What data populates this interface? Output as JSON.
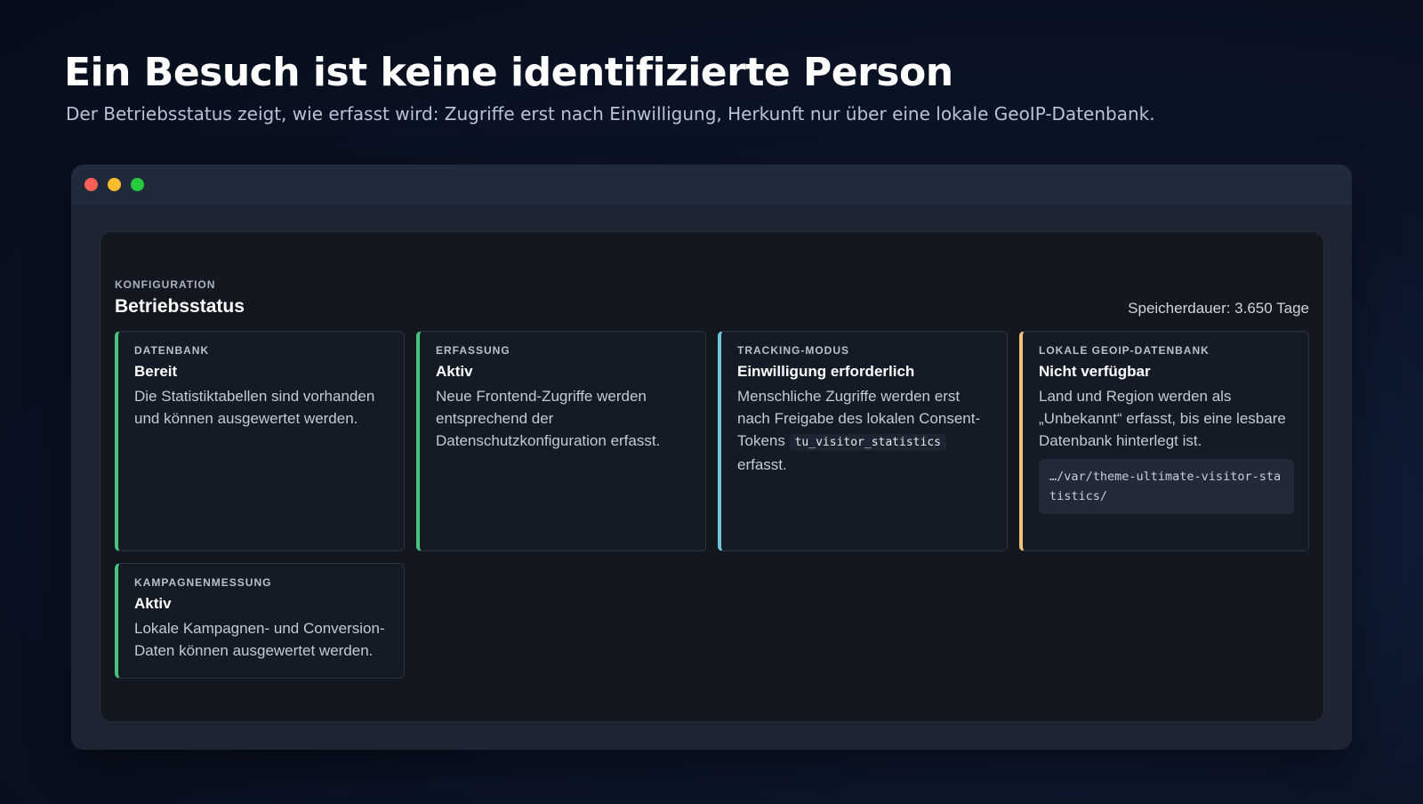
{
  "hero": {
    "title": "Ein Besuch ist keine identifizierte Person",
    "subtitle": "Der Betriebsstatus zeigt, wie erfasst wird: Zugriffe erst nach Einwilligung, Herkunft nur über eine lokale GeoIP-Datenbank."
  },
  "panel": {
    "eyebrow": "KONFIGURATION",
    "title": "Betriebsstatus",
    "retention": "Speicherdauer: 3.650 Tage"
  },
  "cards": [
    {
      "label": "DATENBANK",
      "status": "Bereit",
      "description": "Die Statistiktabellen sind vorhanden und können ausgewertet werden.",
      "accent": "#49c27e"
    },
    {
      "label": "ERFASSUNG",
      "status": "Aktiv",
      "description": "Neue Frontend-Zugriffe werden entsprechend der Datenschutzkonfiguration erfasst.",
      "accent": "#49c27e"
    },
    {
      "label": "TRACKING-MODUS",
      "status": "Einwilligung erforderlich",
      "description_before": "Menschliche Zugriffe werden erst nach Freigabe des lokalen Consent-Tokens",
      "code": "tu_visitor_statistics",
      "description_after": "erfasst.",
      "accent": "#6fc7d8"
    },
    {
      "label": "LOKALE GEOIP-DATENBANK",
      "status": "Nicht verfügbar",
      "description": "Land und Region werden als „Unbekannt“ erfasst, bis eine lesbare Datenbank hinterlegt ist.",
      "path": "…/var/theme-ultimate-visitor-statistics/",
      "accent": "#f0c27a"
    },
    {
      "label": "KAMPAGNENMESSUNG",
      "status": "Aktiv",
      "description": "Lokale Kampagnen- und Conversion-Daten können ausgewertet werden.",
      "accent": "#49c27e"
    }
  ]
}
